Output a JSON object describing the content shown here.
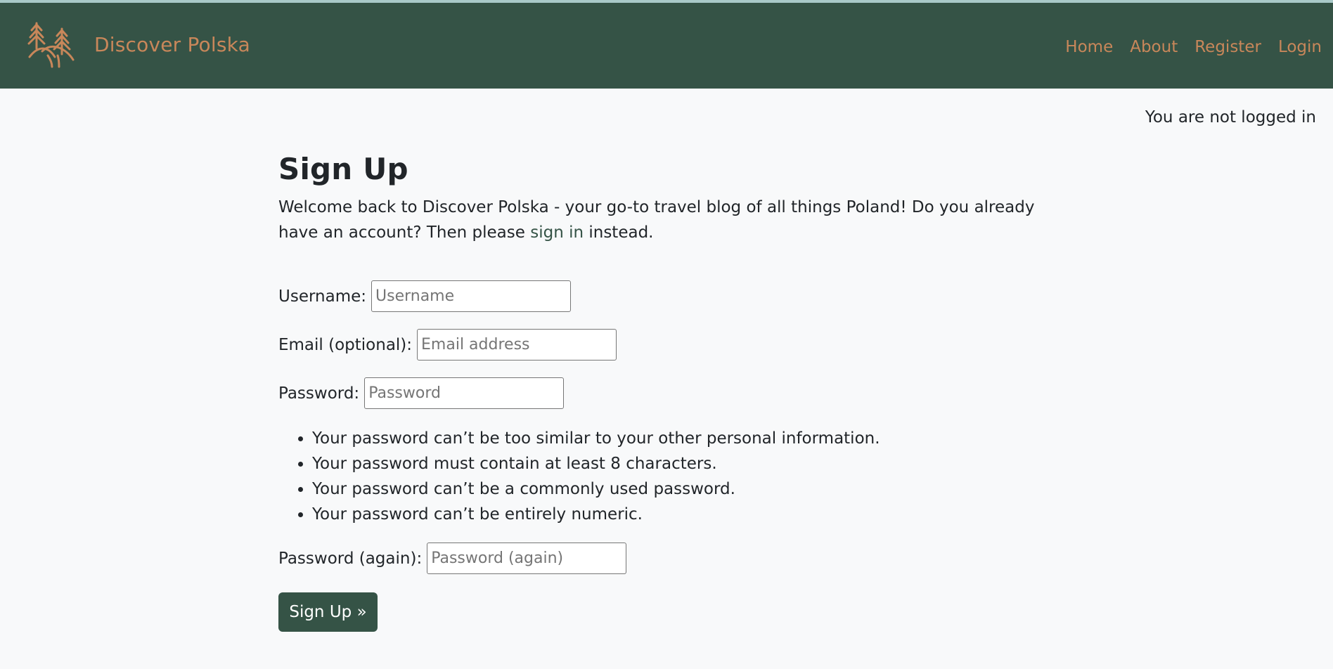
{
  "brand": {
    "name": "Discover Polska",
    "logo_icon": "forest-hills-icon",
    "color": "#c8875a"
  },
  "nav": {
    "items": [
      {
        "label": "Home"
      },
      {
        "label": "About"
      },
      {
        "label": "Register"
      },
      {
        "label": "Login"
      }
    ]
  },
  "status": {
    "text": "You are not logged in"
  },
  "page": {
    "title": "Sign Up",
    "intro_before_link": "Welcome back to Discover Polska - your go-to travel blog of all things Poland! Do you already have an account? Then please ",
    "intro_link": "sign in",
    "intro_after_link": " instead."
  },
  "form": {
    "username": {
      "label": "Username:",
      "placeholder": "Username",
      "value": ""
    },
    "email": {
      "label": "Email (optional):",
      "placeholder": "Email address",
      "value": ""
    },
    "password": {
      "label": "Password:",
      "placeholder": "Password",
      "value": ""
    },
    "password_help": [
      "Your password can’t be too similar to your other personal information.",
      "Your password must contain at least 8 characters.",
      "Your password can’t be a commonly used password.",
      "Your password can’t be entirely numeric."
    ],
    "password_again": {
      "label": "Password (again):",
      "placeholder": "Password (again)",
      "value": ""
    },
    "submit_label": "Sign Up »"
  },
  "colors": {
    "navbar_bg": "#355346",
    "accent": "#c8875a",
    "button_bg": "#355346"
  }
}
